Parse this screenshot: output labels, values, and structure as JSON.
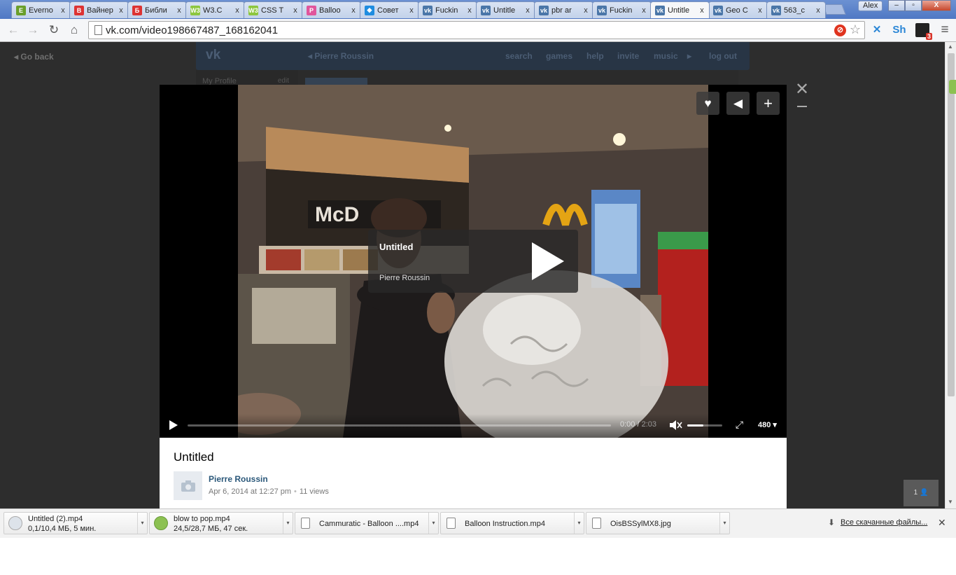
{
  "browser": {
    "tabs": [
      {
        "label": "Everno",
        "fav_color": "#6a9f2b",
        "fav_text": "E"
      },
      {
        "label": "Вайнер",
        "fav_color": "#d33",
        "fav_text": "В"
      },
      {
        "label": "Библи",
        "fav_color": "#d33",
        "fav_text": "Б"
      },
      {
        "label": "W3.C",
        "fav_color": "#8dc63f",
        "fav_text": "W3"
      },
      {
        "label": "CSS T",
        "fav_color": "#8dc63f",
        "fav_text": "W3"
      },
      {
        "label": "Balloo",
        "fav_color": "#e0559c",
        "fav_text": "P"
      },
      {
        "label": "Совет",
        "fav_color": "#1f8de0",
        "fav_text": "◆"
      },
      {
        "label": "Fuckin",
        "fav_color": "#4a76a8",
        "fav_text": "vk"
      },
      {
        "label": "Untitle",
        "fav_color": "#4a76a8",
        "fav_text": "vk"
      },
      {
        "label": "pbr ar",
        "fav_color": "#4a76a8",
        "fav_text": "vk"
      },
      {
        "label": "Fuckin",
        "fav_color": "#4a76a8",
        "fav_text": "vk"
      },
      {
        "label": "Untitle",
        "fav_color": "#4a76a8",
        "fav_text": "vk",
        "active": true
      },
      {
        "label": "Geo C",
        "fav_color": "#4a76a8",
        "fav_text": "vk"
      },
      {
        "label": "563_c",
        "fav_color": "#4a76a8",
        "fav_text": "vk"
      }
    ],
    "tab_close": "x",
    "user": "Alex",
    "window_buttons": {
      "minimize": "–",
      "maximize": "▫",
      "close": "X"
    },
    "url": "vk.com/video198667487_168162041",
    "extensions": [
      {
        "label": "✕",
        "color": "#2a86d6"
      },
      {
        "label": "Sh",
        "color": "#2a86d6"
      },
      {
        "label": "3",
        "color": "#d9352b"
      }
    ]
  },
  "vk": {
    "go_back": "Go back",
    "owner_name": "Pierre Roussin",
    "nav": [
      "search",
      "games",
      "help",
      "invite",
      "music"
    ],
    "logout": "log out",
    "my_profile": "My Profile",
    "edit": "edit"
  },
  "player": {
    "overlay_title": "Untitled",
    "overlay_author": "Pierre Roussin",
    "current_time": "0:00",
    "duration": "2:03",
    "quality": "480",
    "volume_level": 0.45,
    "progress": 0
  },
  "video_info": {
    "title": "Untitled",
    "author": "Pierre Roussin",
    "date": "Apr 6, 2014 at 12:27 pm",
    "views": "11 views"
  },
  "viewers_count": "1",
  "downloads": {
    "items": [
      {
        "name": "Untitled (2).mp4",
        "status": "0,1/10,4 МБ, 5 мин.",
        "icon": "progress"
      },
      {
        "name": "blow to pop.mp4",
        "status": "24,5/28,7 МБ, 47 сек.",
        "icon": "progress-green"
      },
      {
        "name": "Cammuratic - Balloon ....mp4",
        "status": "",
        "icon": "file"
      },
      {
        "name": "Balloon Instruction.mp4",
        "status": "",
        "icon": "file"
      },
      {
        "name": "OisBSSylMX8.jpg",
        "status": "",
        "icon": "image"
      }
    ],
    "all_label": "Все скачанные файлы..."
  }
}
